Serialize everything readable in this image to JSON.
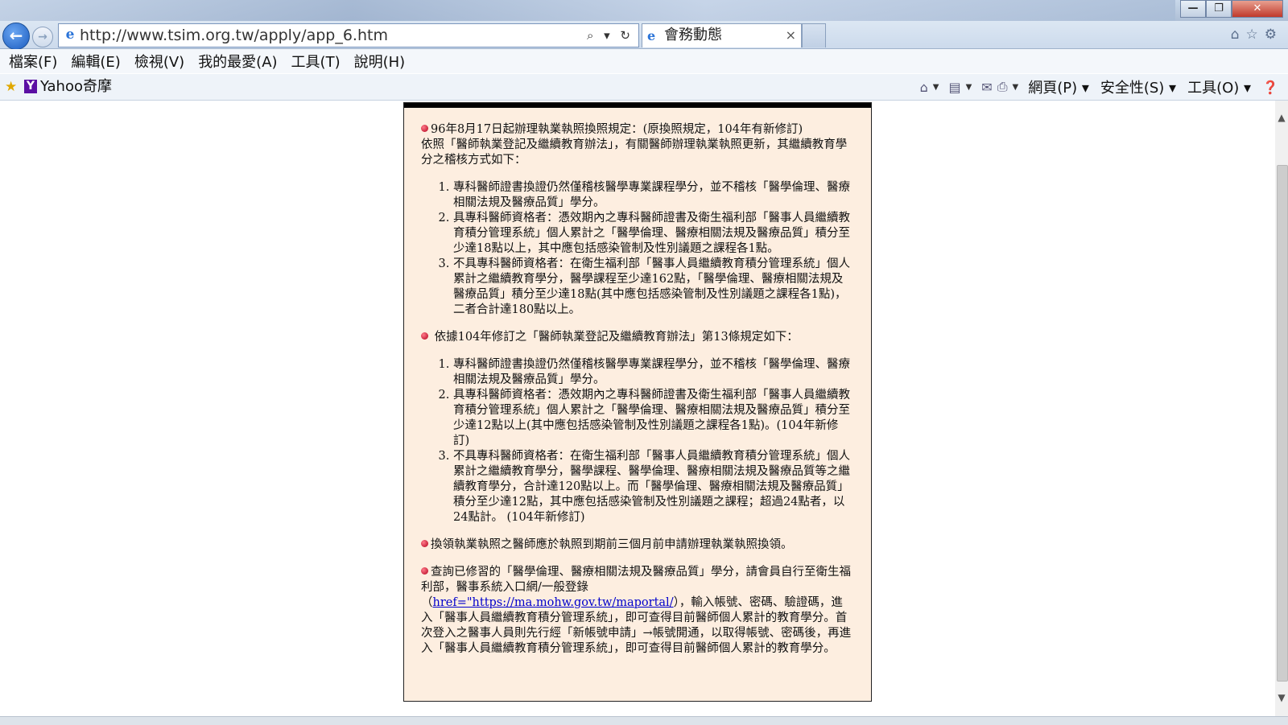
{
  "browser": {
    "url": "http://www.tsim.org.tw/apply/app_6.htm",
    "address_tools": "⌕ ▾ ↻",
    "tab_title": "會務動態",
    "tab_close": "×",
    "window_buttons": {
      "minimize": "—",
      "restore": "❐",
      "close": "✕"
    },
    "nav_icons": [
      "home-icon",
      "star-icon",
      "gear-icon"
    ]
  },
  "menubar": {
    "items": [
      "檔案(F)",
      "編輯(E)",
      "檢視(V)",
      "我的最愛(A)",
      "工具(T)",
      "說明(H)"
    ]
  },
  "favorites": {
    "yahoo_label": "Yahoo奇摩",
    "commands": [
      "網頁(P) ▾",
      "安全性(S) ▾",
      "工具(O) ▾"
    ]
  },
  "content": {
    "section1": {
      "heading": "96年8月17日起辦理執業執照換照規定：(原換照規定，104年有新修訂)",
      "intro": "依照「醫師執業登記及繼續教育辦法」，有關醫師辦理執業執照更新，其繼續教育學分之稽核方式如下：",
      "items": [
        "專科醫師證書換證仍然僅稽核醫學專業課程學分，並不稽核「醫學倫理、醫療相關法規及醫療品質」學分。",
        "具專科醫師資格者：憑效期內之專科醫師證書及衛生福利部「醫事人員繼續教育積分管理系統」個人累計之「醫學倫理、醫療相關法規及醫療品質」積分至少達18點以上，其中應包括感染管制及性別議題之課程各1點。",
        "不具專科醫師資格者：在衛生福利部「醫事人員繼續教育積分管理系統」個人累計之繼續教育學分，醫學課程至少達162點，「醫學倫理、醫療相關法規及醫療品質」積分至少達18點(其中應包括感染管制及性別議題之課程各1點)，二者合計達180點以上。"
      ]
    },
    "section2": {
      "heading": "依據104年修訂之「醫師執業登記及繼續教育辦法」第13條規定如下：",
      "items": [
        "專科醫師證書換證仍然僅稽核醫學專業課程學分，並不稽核「醫學倫理、醫療相關法規及醫療品質」學分。",
        "具專科醫師資格者：憑效期內之專科醫師證書及衛生福利部「醫事人員繼續教育積分管理系統」個人累計之「醫學倫理、醫療相關法規及醫療品質」積分至少達12點以上(其中應包括感染管制及性別議題之課程各1點)。(104年新修訂)",
        "不具專科醫師資格者：在衛生福利部「醫事人員繼續教育積分管理系統」個人累計之繼續教育學分，醫學課程、醫學倫理、醫療相關法規及醫療品質等之繼續教育學分，合計達120點以上。而「醫學倫理、醫療相關法規及醫療品質」積分至少達12點，其中應包括感染管制及性別議題之課程；超過24點者，以24點計。 (104年新修訂)"
      ]
    },
    "section3": {
      "text": "換領執業執照之醫師應於執照到期前三個月前申請辦理執業執照換領。"
    },
    "section4": {
      "text_before": "查詢已修習的「醫學倫理、醫療相關法規及醫療品質」學分，請會員自行至衛生福利部，醫事系統入口網/一般登錄（",
      "link": "href=\"https://ma.mohw.gov.tw/maportal/",
      "text_after": "），輸入帳號、密碼、驗證碼，進入「醫事人員繼續教育積分管理系統」，即可查得目前醫師個人累計的教育學分。首次登入之醫事人員則先行經「新帳號申請」→帳號開通，以取得帳號、密碼後，再進入「醫事人員繼續教育積分管理系統」，即可查得目前醫師個人累計的教育學分。"
    }
  },
  "colors": {
    "panel_bg": "#fdeee0",
    "bullet": "#b3001b",
    "link": "#0000cc"
  }
}
